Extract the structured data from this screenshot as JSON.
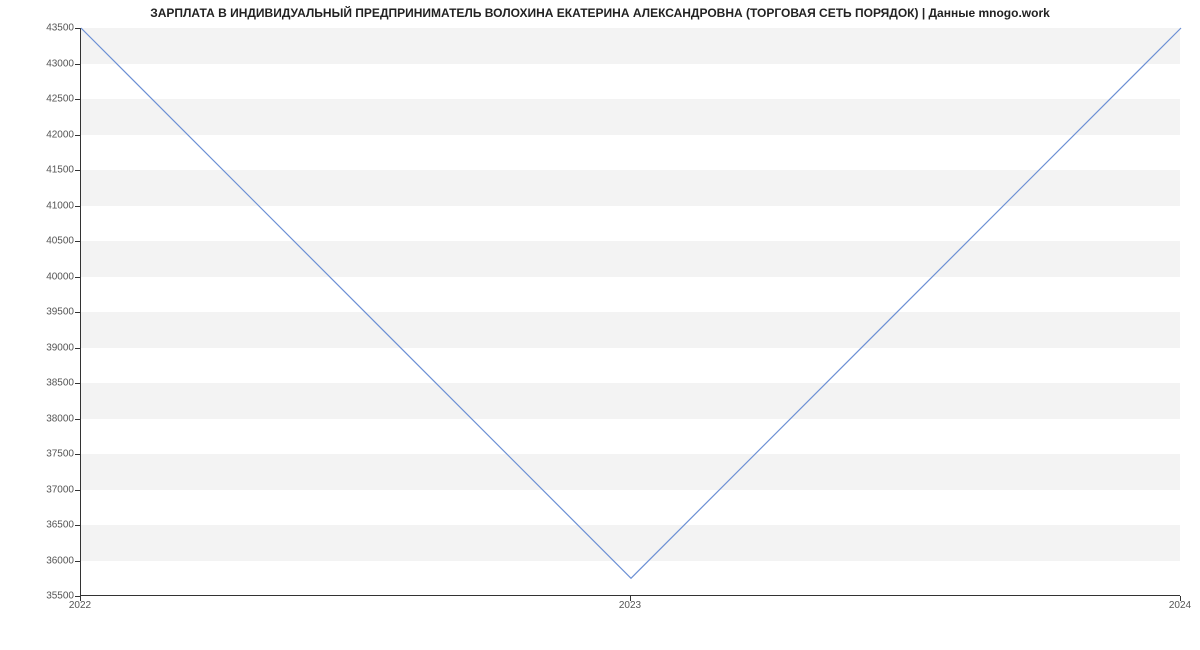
{
  "chart_data": {
    "type": "line",
    "title": "ЗАРПЛАТА В ИНДИВИДУАЛЬНЫЙ ПРЕДПРИНИМАТЕЛЬ ВОЛОХИНА ЕКАТЕРИНА АЛЕКСАНДРОВНА (ТОРГОВАЯ СЕТЬ ПОРЯДОК) | Данные mnogo.work",
    "x": [
      2022,
      2023,
      2024
    ],
    "values": [
      43500,
      35750,
      43500
    ],
    "xlabel": "",
    "ylabel": "",
    "xlim": [
      2022,
      2024
    ],
    "ylim": [
      35500,
      43500
    ],
    "yticks": [
      35500,
      36000,
      36500,
      37000,
      37500,
      38000,
      38500,
      39000,
      39500,
      40000,
      40500,
      41000,
      41500,
      42000,
      42500,
      43000,
      43500
    ],
    "xticks": [
      2022,
      2023,
      2024
    ],
    "band_color": "#f3f3f3",
    "line_color": "#6b8fd4"
  }
}
